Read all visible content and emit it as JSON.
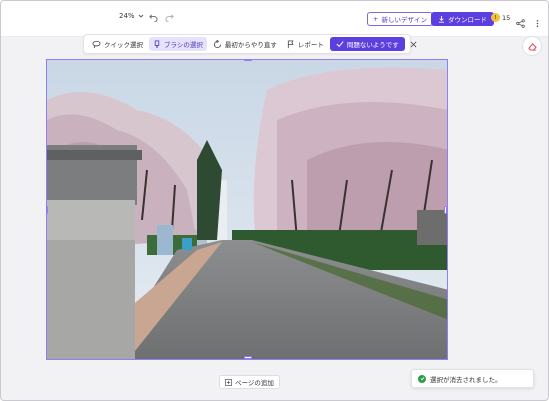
{
  "header": {
    "zoom_label": "24%",
    "new_design_label": "新しいデザイン",
    "download_label": "ダウンロード",
    "credits_count": "15"
  },
  "toolbar": {
    "quick_select_label": "クイック選択",
    "brush_select_label": "ブラシの選択",
    "restart_label": "最初からやり直す",
    "report_label": "レポート",
    "ok_label": "問題ないようです"
  },
  "canvas": {
    "add_page_label": "ページの追加"
  },
  "toast": {
    "message": "選択が消去されました。"
  },
  "colors": {
    "accent": "#5b3fe0",
    "selection_border": "#8f7ff0",
    "success": "#2e9a4b"
  },
  "icons": [
    "chevron-down-icon",
    "undo-icon",
    "redo-icon",
    "plus-icon",
    "download-icon",
    "coin-icon",
    "share-icon",
    "more-icon",
    "eraser-icon",
    "lasso-icon",
    "brush-icon",
    "refresh-icon",
    "flag-icon",
    "check-icon",
    "close-icon",
    "add-page-icon",
    "success-check-icon"
  ]
}
